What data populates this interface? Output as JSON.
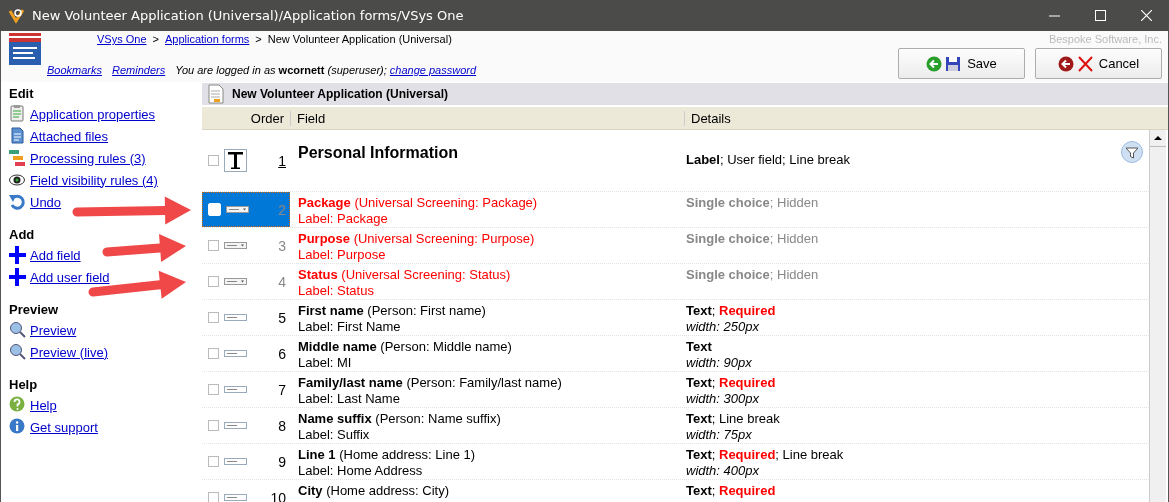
{
  "window": {
    "title": "New Volunteer Application (Universal)/Application forms/VSys One"
  },
  "header": {
    "breadcrumb": [
      {
        "text": "VSys One",
        "link": true
      },
      {
        "text": ">",
        "link": false
      },
      {
        "text": "Application forms",
        "link": true
      },
      {
        "text": ">",
        "link": false
      },
      {
        "text": "New Volunteer Application (Universal)",
        "link": false
      }
    ],
    "links": [
      "Bookmarks",
      "Reminders"
    ],
    "login_text": "*You are logged in as* **wcornett** *(superuser);*",
    "login_link": "change password",
    "company": "Bespoke Software, Inc.",
    "buttons": [
      {
        "label": "Save",
        "kind": "save"
      },
      {
        "label": "Cancel",
        "kind": "cancel"
      }
    ]
  },
  "sidebar": {
    "sections": [
      {
        "title": "Edit",
        "items": [
          {
            "label": "Application properties",
            "kind": "properties"
          },
          {
            "label": "Attached files",
            "kind": "files"
          },
          {
            "label": "Processing rules (3)",
            "kind": "rules"
          },
          {
            "label": "Field visibility rules (4)",
            "kind": "visibility"
          },
          {
            "label": "Undo",
            "kind": "undo"
          }
        ]
      },
      {
        "title": "Add",
        "items": [
          {
            "label": "Add field",
            "kind": "add"
          },
          {
            "label": "Add user field",
            "kind": "add"
          }
        ]
      },
      {
        "title": "Preview",
        "items": [
          {
            "label": "Preview",
            "kind": "preview"
          },
          {
            "label": "Preview (live)",
            "kind": "preview"
          }
        ]
      },
      {
        "title": "Help",
        "items": [
          {
            "label": "Help",
            "kind": "help"
          },
          {
            "label": "Get support",
            "kind": "info"
          }
        ]
      }
    ]
  },
  "form": {
    "title": "New Volunteer Application (Universal)",
    "columns": [
      "Order",
      "Field",
      "Details"
    ],
    "rows": [
      {
        "kind": "heading",
        "order": "1",
        "checked": false,
        "selected": false,
        "hidden": false,
        "field": "Personal Information",
        "details": [
          {
            "text": "Label",
            "kind": "type"
          },
          {
            "text": "; User field; Line break",
            "kind": "plain"
          }
        ]
      },
      {
        "kind": "choice",
        "order": "2",
        "checked": false,
        "selected": true,
        "hidden": true,
        "field": "**Package** (Universal Screening: Package)",
        "label": "Label: Package",
        "details": [
          {
            "text": "Single choice",
            "kind": "type"
          },
          {
            "text": "; Hidden",
            "kind": "plain"
          }
        ]
      },
      {
        "kind": "choice",
        "order": "3",
        "checked": false,
        "selected": false,
        "hidden": true,
        "field": "**Purpose** (Universal Screening: Purpose)",
        "label": "Label: Purpose",
        "details": [
          {
            "text": "Single choice",
            "kind": "type"
          },
          {
            "text": "; Hidden",
            "kind": "plain"
          }
        ]
      },
      {
        "kind": "choice",
        "order": "4",
        "checked": false,
        "selected": false,
        "hidden": true,
        "field": "**Status** (Universal Screening: Status)",
        "label": "Label: Status",
        "details": [
          {
            "text": "Single choice",
            "kind": "type"
          },
          {
            "text": "; Hidden",
            "kind": "plain"
          }
        ]
      },
      {
        "kind": "text",
        "order": "5",
        "checked": false,
        "selected": false,
        "hidden": false,
        "field": "**First name** (Person: First name)",
        "label": "Label: First Name",
        "details": [
          {
            "text": "Text",
            "kind": "type"
          },
          {
            "text": "; ",
            "kind": "plain"
          },
          {
            "text": "Required",
            "kind": "required"
          }
        ],
        "width": "width: 250px"
      },
      {
        "kind": "text",
        "order": "6",
        "checked": false,
        "selected": false,
        "hidden": false,
        "field": "**Middle name** (Person: Middle name)",
        "label": "Label: MI",
        "details": [
          {
            "text": "Text",
            "kind": "type"
          }
        ],
        "width": "width: 90px"
      },
      {
        "kind": "text",
        "order": "7",
        "checked": false,
        "selected": false,
        "hidden": false,
        "field": "**Family/last name** (Person: Family/last name)",
        "label": "Label: Last Name",
        "details": [
          {
            "text": "Text",
            "kind": "type"
          },
          {
            "text": "; ",
            "kind": "plain"
          },
          {
            "text": "Required",
            "kind": "required"
          }
        ],
        "width": "width: 300px"
      },
      {
        "kind": "text",
        "order": "8",
        "checked": false,
        "selected": false,
        "hidden": false,
        "field": "**Name suffix** (Person: Name suffix)",
        "label": "Label: Suffix",
        "details": [
          {
            "text": "Text",
            "kind": "type"
          },
          {
            "text": "; Line break",
            "kind": "plain"
          }
        ],
        "width": "width: 75px"
      },
      {
        "kind": "text",
        "order": "9",
        "checked": false,
        "selected": false,
        "hidden": false,
        "field": "**Line 1** (Home address: Line 1)",
        "label": "Label: Home Address",
        "details": [
          {
            "text": "Text",
            "kind": "type"
          },
          {
            "text": "; ",
            "kind": "plain"
          },
          {
            "text": "Required",
            "kind": "required"
          },
          {
            "text": "; Line break",
            "kind": "plain"
          }
        ],
        "width": "width: 400px"
      },
      {
        "kind": "text",
        "order": "10",
        "checked": false,
        "selected": false,
        "hidden": false,
        "field": "**City** (Home address: City)",
        "details": [
          {
            "text": "Text",
            "kind": "type"
          },
          {
            "text": "; ",
            "kind": "plain"
          },
          {
            "text": "Required",
            "kind": "required"
          }
        ]
      }
    ]
  }
}
